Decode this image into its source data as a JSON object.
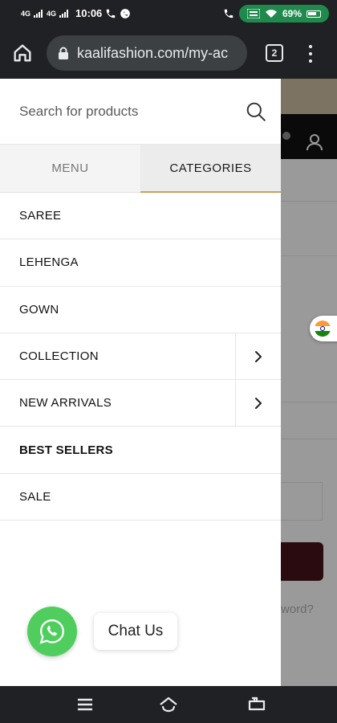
{
  "status_bar": {
    "time": "10:06",
    "signal_1": "4G",
    "signal_2": "4G",
    "battery": "69%",
    "icons": [
      "call-icon",
      "whatsapp-status-icon",
      "wifi-calling-icon",
      "volte-icon",
      "wifi-icon",
      "battery-icon"
    ]
  },
  "browser": {
    "url": "kaalifashion.com/my-ac",
    "tab_count": "2",
    "icons": [
      "home-icon",
      "lock-icon",
      "overflow-menu-icon"
    ]
  },
  "drawer": {
    "search": {
      "placeholder": "Search for products",
      "icon": "search-icon"
    },
    "tabs": [
      {
        "label": "MENU",
        "active": false
      },
      {
        "label": "CATEGORIES",
        "active": true
      }
    ],
    "active_tab_color": "#c9a25f",
    "categories": [
      {
        "label": "SAREE",
        "has_children": false
      },
      {
        "label": "LEHENGA",
        "has_children": false
      },
      {
        "label": "GOWN",
        "has_children": false
      },
      {
        "label": "COLLECTION",
        "has_children": true
      },
      {
        "label": "NEW ARRIVALS",
        "has_children": true
      },
      {
        "label": "BEST SELLERS",
        "has_children": false
      },
      {
        "label": "SALE",
        "has_children": false
      }
    ]
  },
  "background": {
    "forgot_text": "word?",
    "flag": "india-flag-icon"
  },
  "whatsapp": {
    "label": "Chat Us",
    "color": "#4fce5d"
  },
  "nav_bar": {
    "icons": [
      "recents-menu-icon",
      "home-nav-icon",
      "back-nav-icon"
    ]
  }
}
